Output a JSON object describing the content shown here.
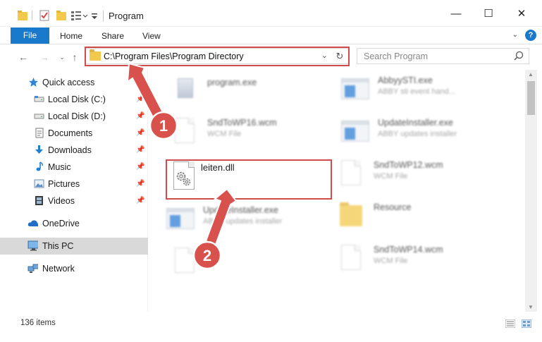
{
  "window": {
    "title": "Program",
    "controls": {
      "minimize": "—",
      "maximize": "☐",
      "close": "✕"
    }
  },
  "ribbon": {
    "tabs": [
      "File",
      "Home",
      "Share",
      "View"
    ],
    "help": "?"
  },
  "navigation": {
    "address_path": "C:\\Program Files\\Program Directory",
    "search_placeholder": "Search Program"
  },
  "sidebar": {
    "items": [
      {
        "label": "Quick access",
        "icon": "star-icon"
      },
      {
        "label": "Local Disk (C:)",
        "icon": "drive-icon",
        "pinned": true
      },
      {
        "label": "Local Disk (D:)",
        "icon": "drive-icon",
        "pinned": true
      },
      {
        "label": "Documents",
        "icon": "documents-icon",
        "pinned": true
      },
      {
        "label": "Downloads",
        "icon": "download-arrow-icon",
        "pinned": true
      },
      {
        "label": "Music",
        "icon": "music-note-icon",
        "pinned": true
      },
      {
        "label": "Pictures",
        "icon": "pictures-icon",
        "pinned": true
      },
      {
        "label": "Videos",
        "icon": "film-icon",
        "pinned": true
      },
      {
        "label": "OneDrive",
        "icon": "cloud-icon"
      },
      {
        "label": "This PC",
        "icon": "monitor-icon",
        "selected": true
      },
      {
        "label": "Network",
        "icon": "network-icon"
      }
    ]
  },
  "files": [
    {
      "name": "program.exe",
      "type": "",
      "icon": "exe-icon"
    },
    {
      "name": "AbbyySTI.exe",
      "type": "ABBY sti event hand...",
      "icon": "app-window-icon"
    },
    {
      "name": "SndToWP16.wcm",
      "type": "WCM File",
      "icon": "blank-document-icon"
    },
    {
      "name": "UpdateInstaller.exe",
      "type": "ABBY updates installer",
      "icon": "app-window-icon"
    },
    {
      "name": "leiten.dll",
      "type": "",
      "icon": "dll-gears-icon"
    },
    {
      "name": "SndToWP12.wcm",
      "type": "WCM File",
      "icon": "blank-document-icon"
    },
    {
      "name": "UpdateInstaller.exe",
      "type": "ABBY updates installer",
      "icon": "app-window-icon"
    },
    {
      "name": "Resource",
      "type": "",
      "icon": "folder-icon"
    },
    {
      "name": "SndToWP14.wcm",
      "type": "WCM File",
      "icon": "blank-document-icon"
    }
  ],
  "status": {
    "item_count": "136 items"
  },
  "annotations": {
    "labels": [
      "1",
      "2"
    ],
    "color": "#d8514d"
  }
}
